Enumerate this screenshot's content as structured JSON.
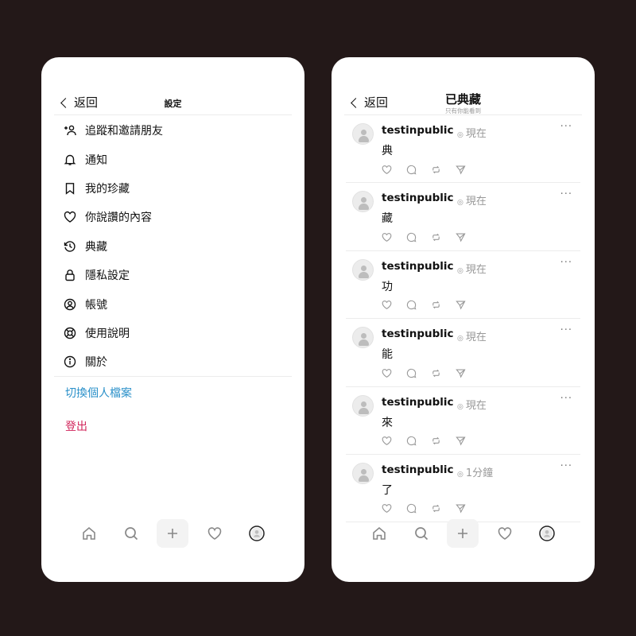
{
  "settings": {
    "back_label": "返回",
    "title": "設定",
    "menu": [
      {
        "label": "追蹤和邀請朋友",
        "icon": "add-person-icon"
      },
      {
        "label": "通知",
        "icon": "bell-icon"
      },
      {
        "label": "我的珍藏",
        "icon": "bookmark-icon"
      },
      {
        "label": "你說讚的內容",
        "icon": "heart-icon"
      },
      {
        "label": "典藏",
        "icon": "archive-clock-icon"
      },
      {
        "label": "隱私設定",
        "icon": "lock-icon"
      },
      {
        "label": "帳號",
        "icon": "account-circle-icon"
      },
      {
        "label": "使用說明",
        "icon": "lifebuoy-icon"
      },
      {
        "label": "關於",
        "icon": "info-icon"
      }
    ],
    "switch_profile": "切換個人檔案",
    "logout": "登出"
  },
  "archive": {
    "back_label": "返回",
    "title": "已典藏",
    "subtitle": "只有你能看到",
    "more": "···",
    "posts": [
      {
        "user": "testinpublic",
        "time": "現在",
        "text": "典"
      },
      {
        "user": "testinpublic",
        "time": "現在",
        "text": "藏"
      },
      {
        "user": "testinpublic",
        "time": "現在",
        "text": "功"
      },
      {
        "user": "testinpublic",
        "time": "現在",
        "text": "能"
      },
      {
        "user": "testinpublic",
        "time": "現在",
        "text": "來"
      },
      {
        "user": "testinpublic",
        "time": "1分鐘",
        "text": "了"
      }
    ]
  },
  "tabbar": [
    "home-icon",
    "search-icon",
    "plus-icon",
    "heart-icon",
    "profile-icon"
  ],
  "colors": {
    "background": "#231818",
    "link": "#2a90c9",
    "logout": "#d1245a",
    "muted": "#999999"
  }
}
